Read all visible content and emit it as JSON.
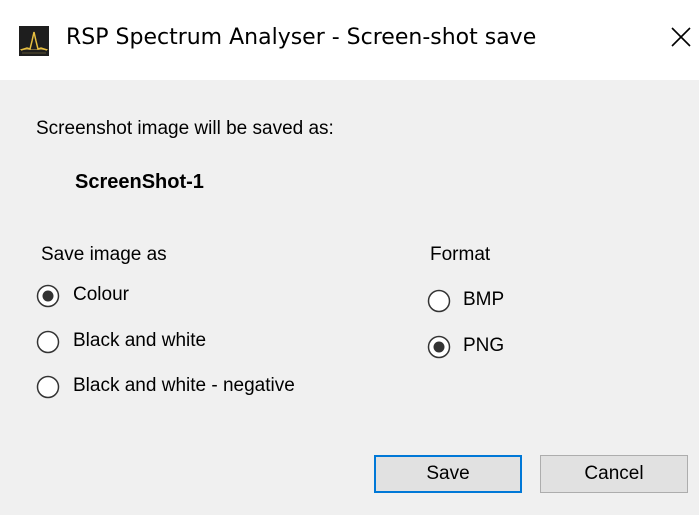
{
  "window": {
    "title": "RSP Spectrum Analyser - Screen-shot save",
    "icon": "spectrum-app-icon",
    "close_icon": "close-icon"
  },
  "info": {
    "label": "Screenshot image will be saved as:",
    "filename": "ScreenShot-1"
  },
  "save_as": {
    "heading": "Save image as",
    "options": [
      {
        "label": "Colour",
        "checked": true
      },
      {
        "label": "Black and white",
        "checked": false
      },
      {
        "label": "Black and white - negative",
        "checked": false
      }
    ]
  },
  "format": {
    "heading": "Format",
    "options": [
      {
        "label": "BMP",
        "checked": false
      },
      {
        "label": "PNG",
        "checked": true
      }
    ]
  },
  "buttons": {
    "save_label": "Save",
    "cancel_label": "Cancel"
  },
  "colors": {
    "accent": "#0078d7",
    "title_bar": "#ffffff",
    "dialog_background": "#f0f0f0"
  }
}
